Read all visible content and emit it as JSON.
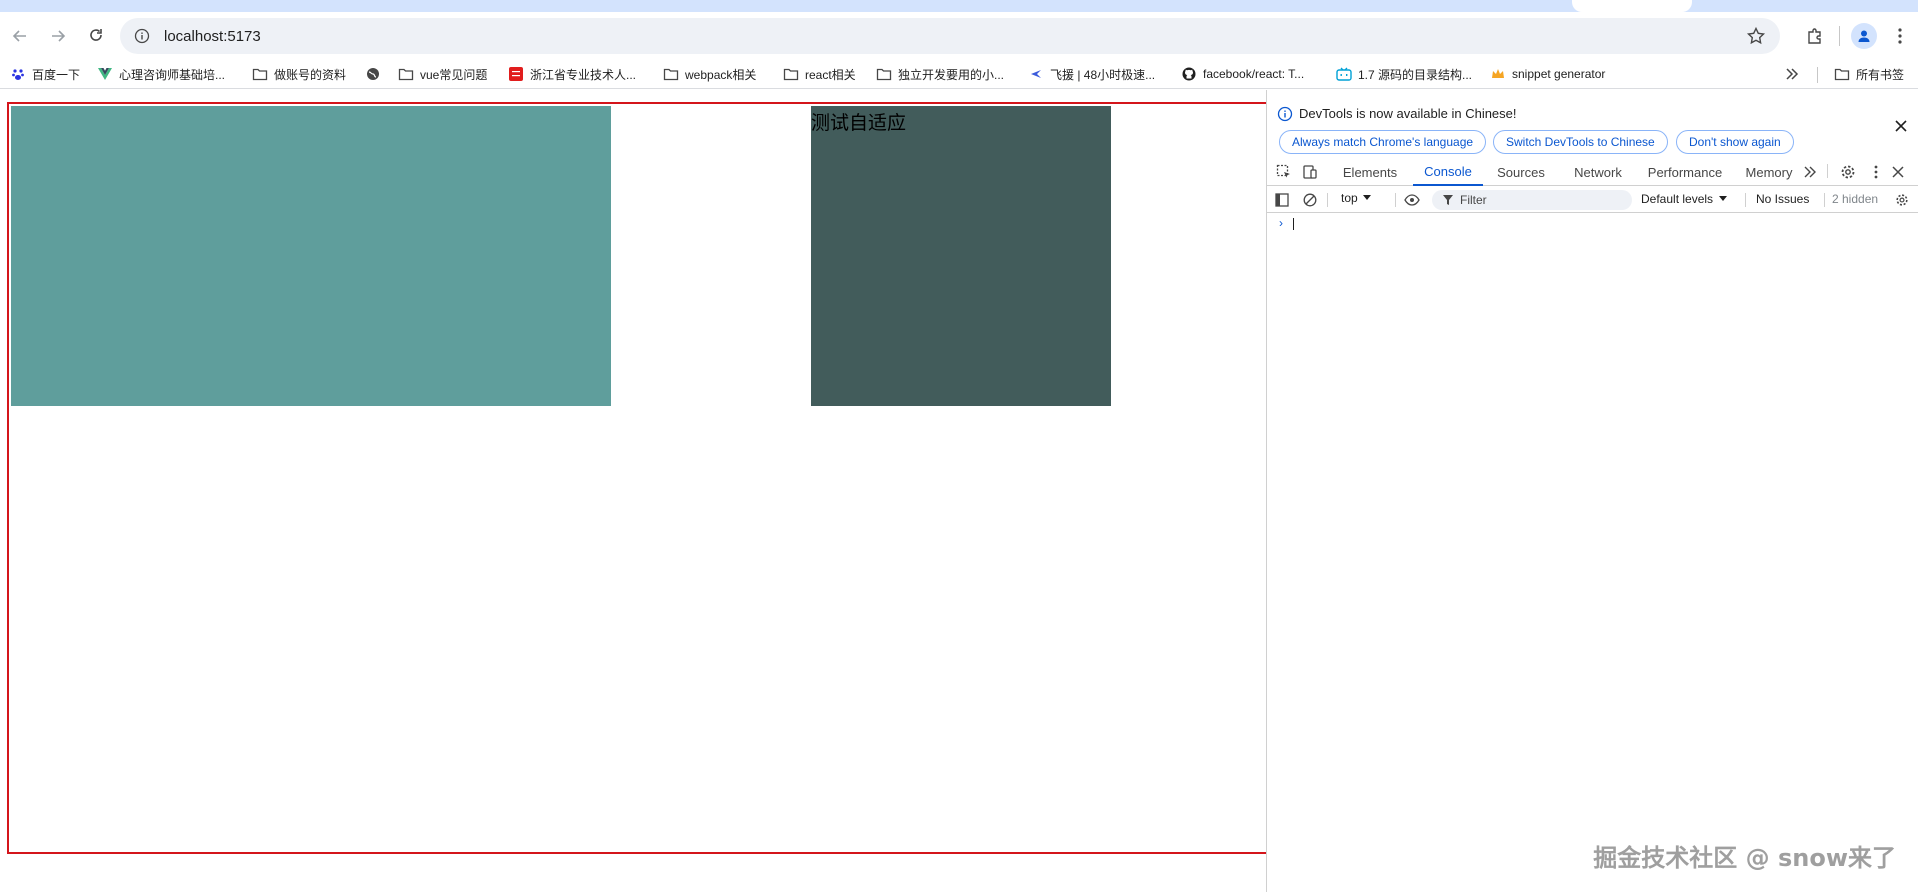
{
  "browser": {
    "url": "localhost:5173",
    "bookmarks": [
      {
        "label": "百度一下",
        "icon": "paw-icon"
      },
      {
        "label": "心理咨询师基础培...",
        "icon": "vue-logo-icon"
      },
      {
        "label": "做账号的资料",
        "icon": "folder-icon"
      },
      {
        "label": "",
        "icon": "globe-icon"
      },
      {
        "label": "vue常见问题",
        "icon": "folder-icon"
      },
      {
        "label": "浙江省专业技术人...",
        "icon": "red-badge-icon"
      },
      {
        "label": "webpack相关",
        "icon": "folder-icon"
      },
      {
        "label": "react相关",
        "icon": "folder-icon"
      },
      {
        "label": "独立开发要用的小...",
        "icon": "folder-icon"
      },
      {
        "label": "飞援 | 48小时极速...",
        "icon": "arrow-icon"
      },
      {
        "label": "facebook/react: T...",
        "icon": "github-icon"
      },
      {
        "label": "1.7 源码的目录结构...",
        "icon": "bilibili-icon"
      },
      {
        "label": "snippet generator",
        "icon": "crown-icon"
      }
    ],
    "all_bookmarks": "所有书签"
  },
  "page": {
    "text": "测试自适应",
    "colors": {
      "frame": "#d4151b",
      "box_a": "#5f9e9c",
      "box_b": "#425c5b"
    }
  },
  "devtools": {
    "banner": {
      "message": "DevTools is now available in Chinese!",
      "buttons": [
        "Always match Chrome's language",
        "Switch DevTools to Chinese",
        "Don't show again"
      ]
    },
    "tabs": [
      "Elements",
      "Console",
      "Sources",
      "Network",
      "Performance",
      "Memory"
    ],
    "active_tab": "Console",
    "console": {
      "context": "top",
      "filter_placeholder": "Filter",
      "levels": "Default levels",
      "issues": "No Issues",
      "hidden": "2 hidden",
      "prompt": "›"
    }
  },
  "watermark": "掘金技术社区 @ snow来了"
}
